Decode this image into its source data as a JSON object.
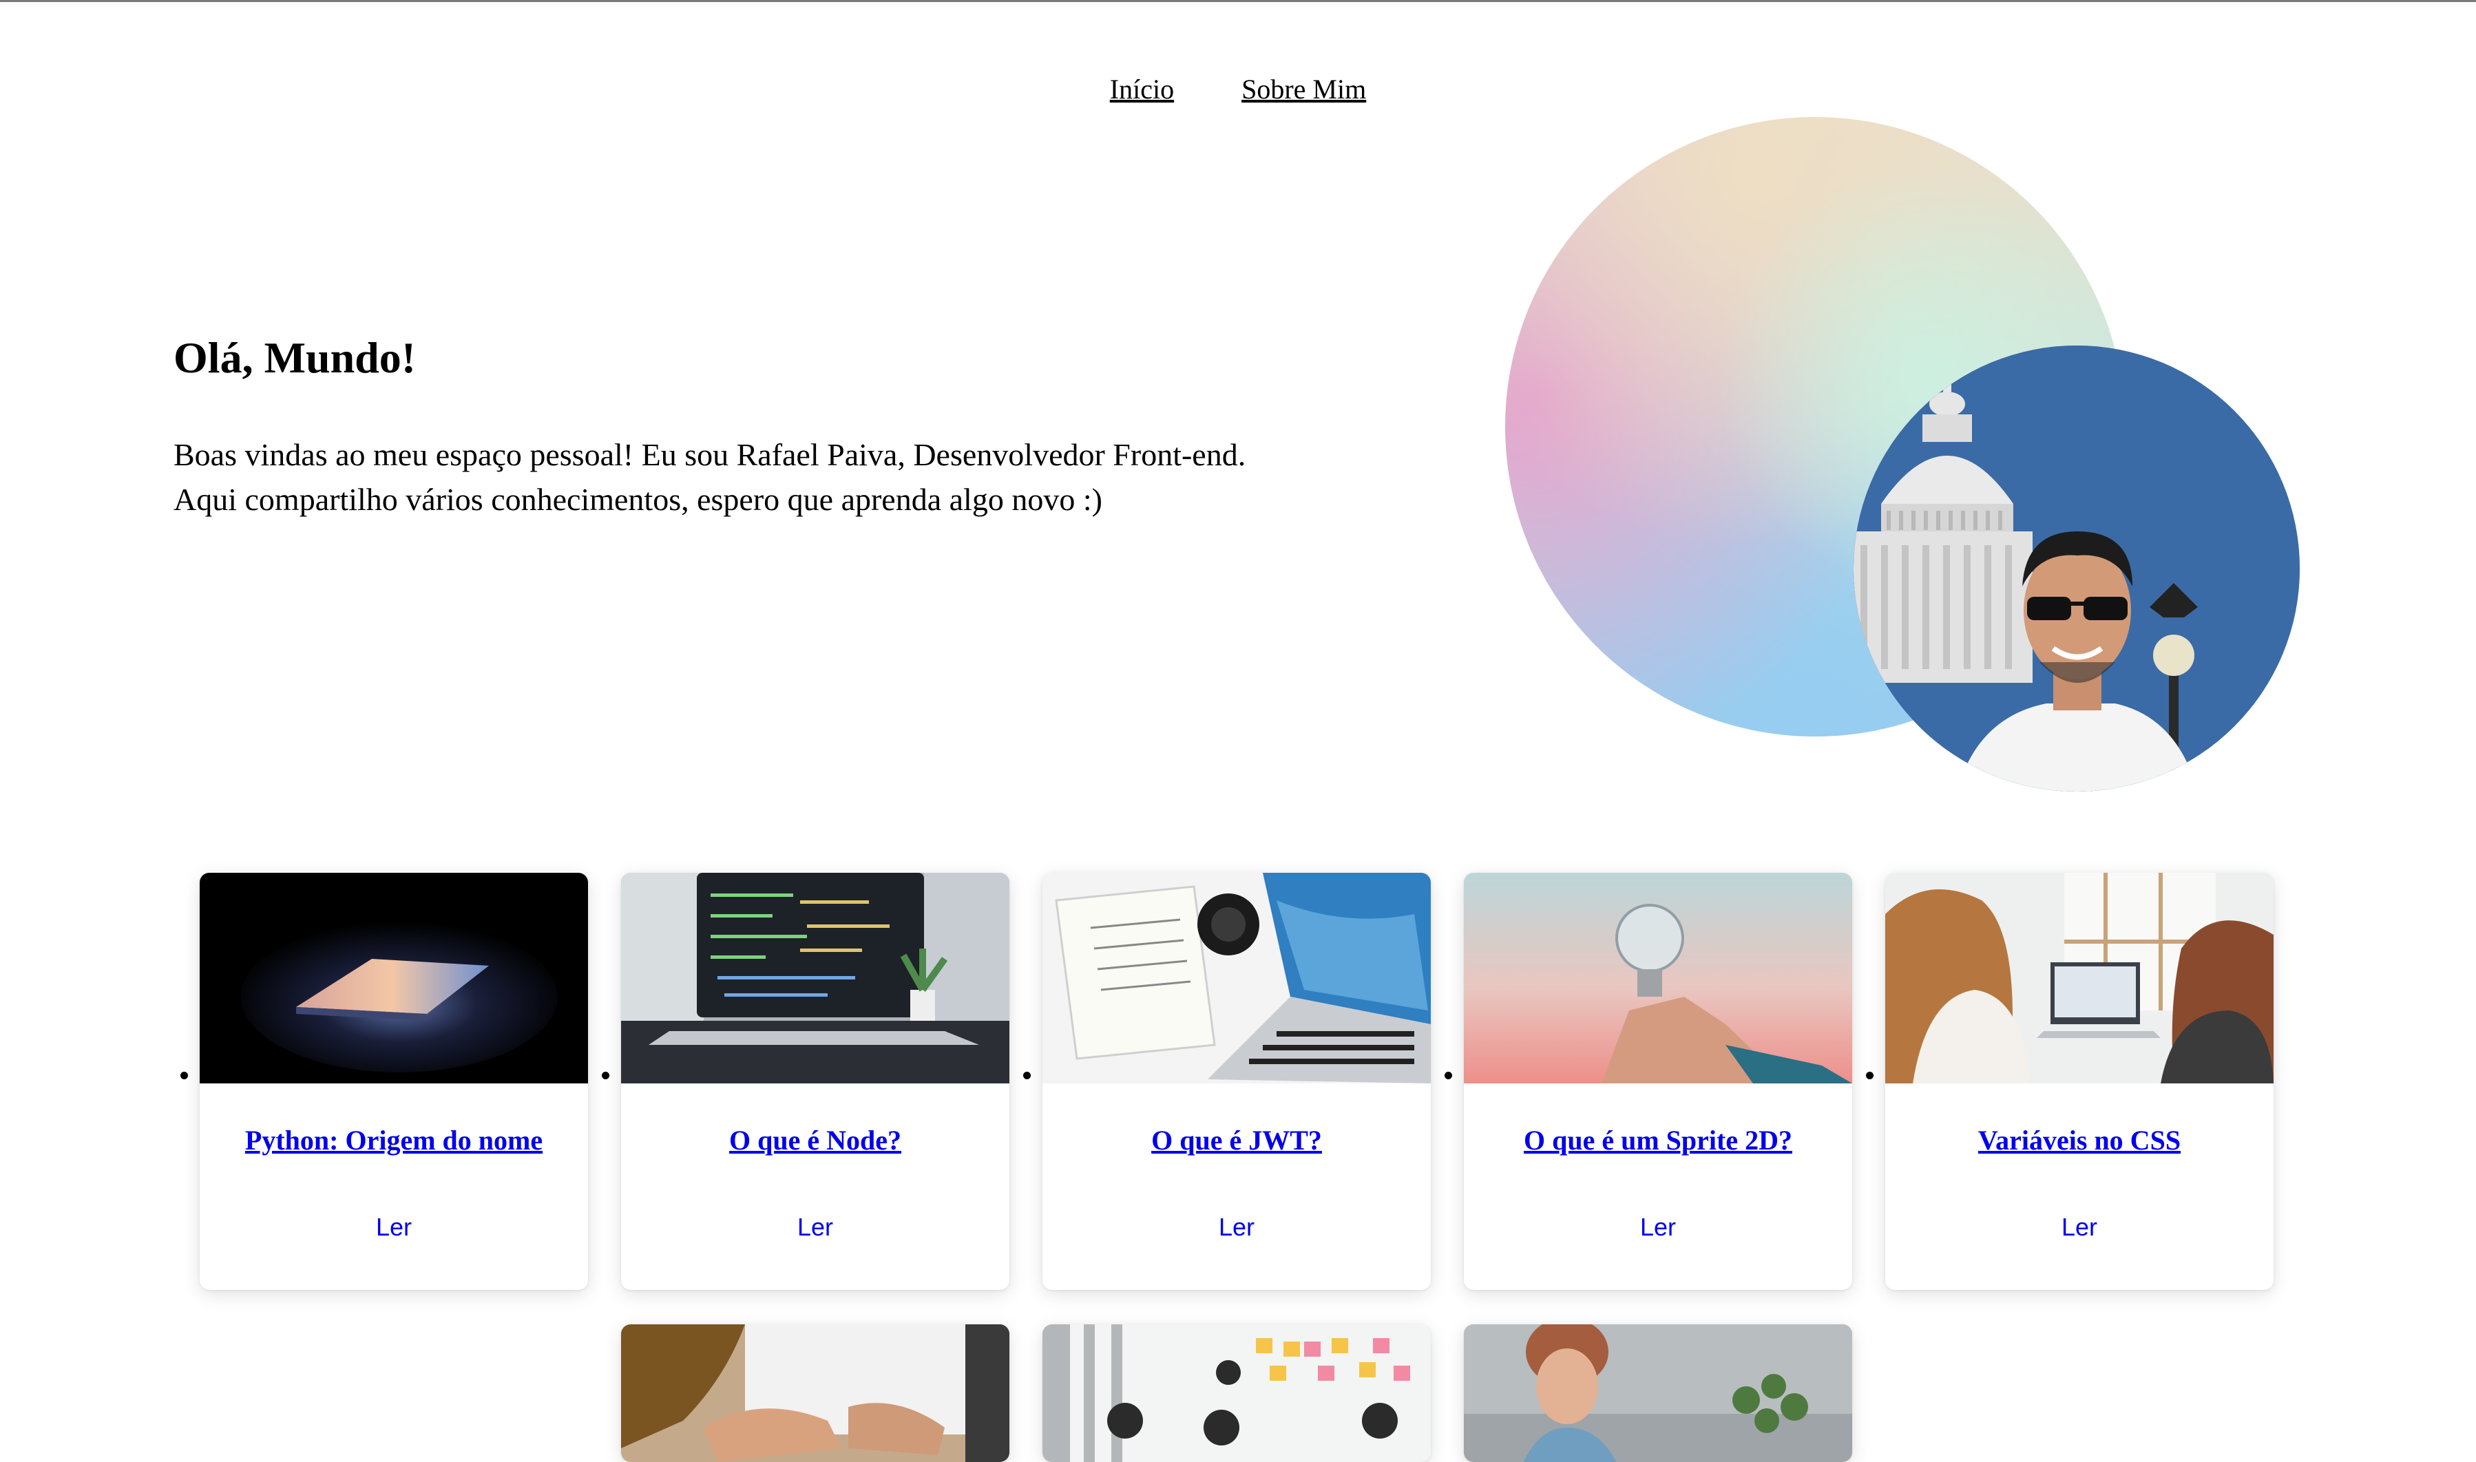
{
  "nav": {
    "home_label": "Início",
    "about_label": "Sobre Mim"
  },
  "hero": {
    "title": "Olá, Mundo!",
    "text": "Boas vindas ao meu espaço pessoal! Eu sou Rafael Paiva, Desenvolvedor Front-end. Aqui compartilho vários conhecimentos, espero que aprenda algo novo :)"
  },
  "posts": [
    {
      "title": "Python: Origem do nome",
      "read_label": "Ler",
      "thumb_icon": "laptop-photo"
    },
    {
      "title": "O que é Node?",
      "read_label": "Ler",
      "thumb_icon": "code-laptop-photo"
    },
    {
      "title": "O que é JWT?",
      "read_label": "Ler",
      "thumb_icon": "desk-laptop-photo"
    },
    {
      "title": "O que é um Sprite 2D?",
      "read_label": "Ler",
      "thumb_icon": "lightbulb-photo"
    },
    {
      "title": "Variáveis no CSS",
      "read_label": "Ler",
      "thumb_icon": "meeting-photo"
    },
    {
      "title": "",
      "read_label": "",
      "thumb_icon": "typing-photo"
    },
    {
      "title": "",
      "read_label": "",
      "thumb_icon": "sticky-notes-photo"
    },
    {
      "title": "",
      "read_label": "",
      "thumb_icon": "office-photo"
    }
  ],
  "colors": {
    "link": "#0000ee",
    "avatar_sky": "#3d71ab"
  }
}
